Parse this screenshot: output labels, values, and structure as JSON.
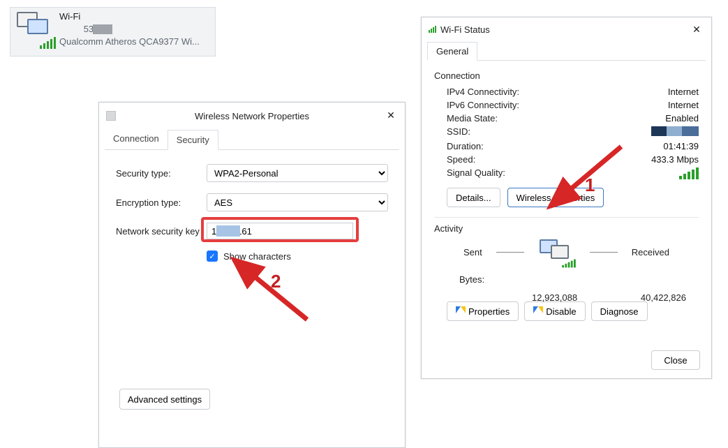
{
  "adapter": {
    "name": "Wi-Fi",
    "ssid_partial": "534",
    "device": "Qualcomm Atheros QCA9377 Wi..."
  },
  "props_dialog": {
    "title": "Wireless Network Properties",
    "tabs": {
      "connection": "Connection",
      "security": "Security"
    },
    "security_type_label": "Security type:",
    "security_type_value": "WPA2-Personal",
    "encryption_label": "Encryption type:",
    "encryption_value": "AES",
    "key_label": "Network security key",
    "key_value": "1      0161",
    "show_characters": "Show characters",
    "advanced": "Advanced settings"
  },
  "status_dialog": {
    "title": "Wi-Fi Status",
    "tab_general": "General",
    "group_connection": "Connection",
    "ipv4_label": "IPv4 Connectivity:",
    "ipv4_value": "Internet",
    "ipv6_label": "IPv6 Connectivity:",
    "ipv6_value": "Internet",
    "media_label": "Media State:",
    "media_value": "Enabled",
    "ssid_label": "SSID:",
    "duration_label": "Duration:",
    "duration_value": "01:41:39",
    "speed_label": "Speed:",
    "speed_value": "433.3 Mbps",
    "signal_label": "Signal Quality:",
    "details_btn": "Details...",
    "wireless_btn": "Wireless Properties",
    "group_activity": "Activity",
    "sent": "Sent",
    "received": "Received",
    "bytes_label": "Bytes:",
    "bytes_sent": "12,923,088",
    "bytes_recv": "40,422,826",
    "properties_btn": "Properties",
    "disable_btn": "Disable",
    "diagnose_btn": "Diagnose",
    "close_btn": "Close"
  },
  "annotations": {
    "one": "1",
    "two": "2"
  }
}
